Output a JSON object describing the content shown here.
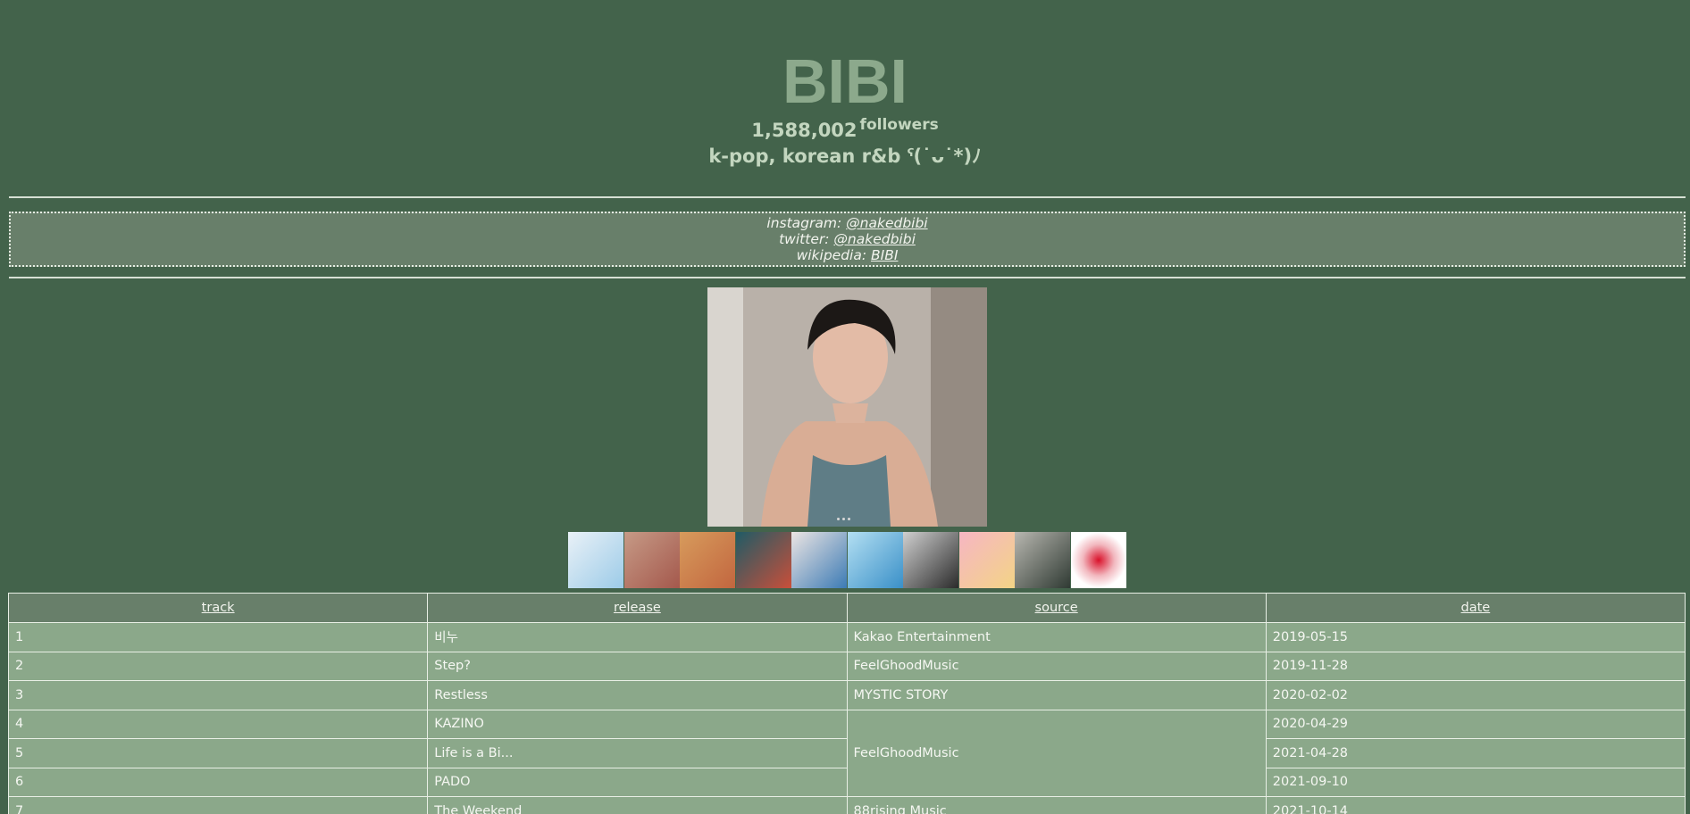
{
  "artist": {
    "name": "BIBI",
    "followers_count": "1,588,002",
    "followers_label": "followers",
    "genres": "k-pop, korean r&b ˁ(˙ᴗ˙*)ﾉ"
  },
  "links": {
    "instagram_label": "instagram:",
    "instagram_handle": "@nakedbibi",
    "twitter_label": "twitter:",
    "twitter_handle": "@nakedbibi",
    "wikipedia_label": "wikipedia:",
    "wikipedia_link": "BIBI"
  },
  "colors": {
    "background": "#43634b",
    "title": "#8ca98c",
    "header_cell": "#687f6a",
    "body_cell": "#8ba88a"
  },
  "table": {
    "headers": [
      "track",
      "release",
      "source",
      "date"
    ],
    "rows": [
      {
        "track": "1",
        "release": "비누",
        "source": "Kakao Entertainment",
        "date": "2019-05-15"
      },
      {
        "track": "2",
        "release": "Step?",
        "source": "FeelGhoodMusic",
        "date": "2019-11-28"
      },
      {
        "track": "3",
        "release": "Restless",
        "source": "MYSTIC STORY",
        "date": "2020-02-02"
      },
      {
        "track": "4",
        "release": "KAZINO",
        "source": "FeelGhoodMusic",
        "date": "2020-04-29"
      },
      {
        "track": "5",
        "release": "Life is a Bi...",
        "source": "",
        "date": "2021-04-28"
      },
      {
        "track": "6",
        "release": "PADO",
        "source": "",
        "date": "2021-09-10"
      },
      {
        "track": "7",
        "release": "The Weekend",
        "source": "88rising Music",
        "date": "2021-10-14"
      }
    ]
  }
}
